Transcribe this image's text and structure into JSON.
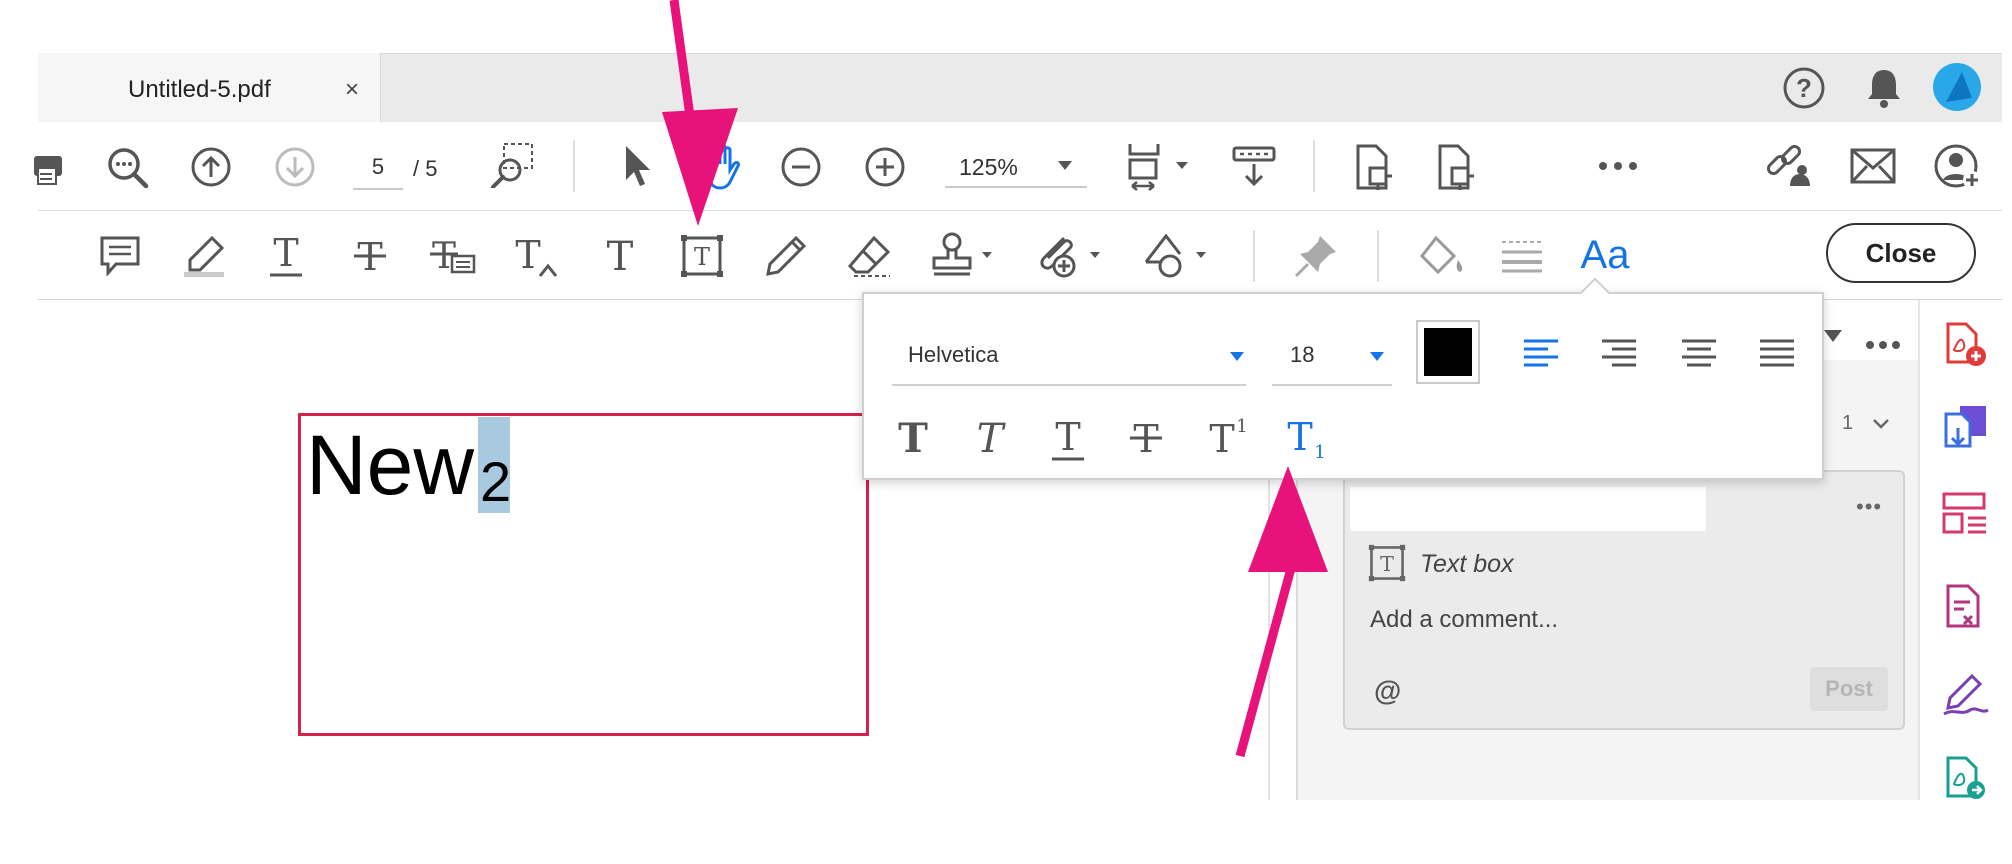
{
  "tab": {
    "title": "Untitled-5.pdf",
    "close": "×"
  },
  "toolbar": {
    "page_current": "5",
    "page_total": "/ 5",
    "zoom": "125%",
    "close_label": "Close"
  },
  "format_popup": {
    "font": "Helvetica",
    "size": "18",
    "color": "#000000"
  },
  "document": {
    "textbox_main": "New",
    "textbox_subscript": "2"
  },
  "comments": {
    "page_indicator": "1",
    "item_type": "Text box",
    "comment_placeholder": "Add a comment...",
    "mention": "@",
    "post_label": "Post",
    "more": "•••"
  },
  "colors": {
    "accent": "#1473e6",
    "annotation_arrow": "#e8137a",
    "textbox_border": "#d4224a",
    "highlight": "#a8c9e0"
  }
}
